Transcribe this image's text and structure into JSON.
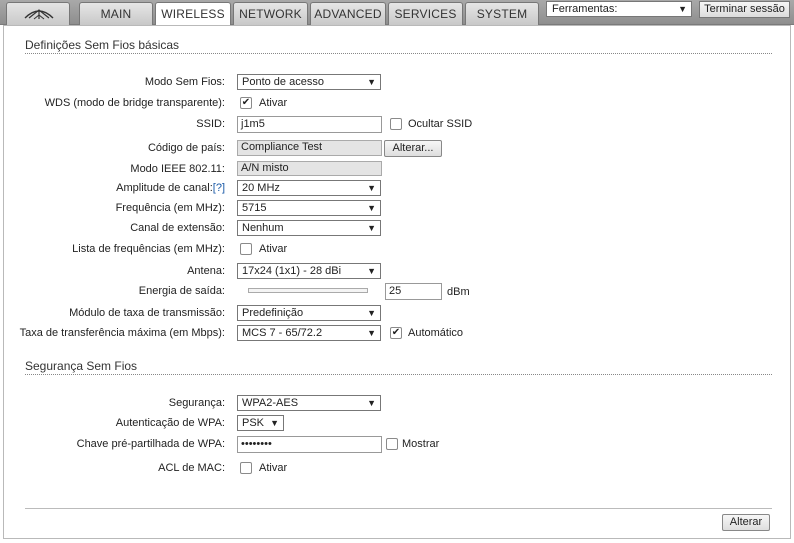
{
  "tabs": [
    {
      "label": "MAIN"
    },
    {
      "label": "WIRELESS"
    },
    {
      "label": "NETWORK"
    },
    {
      "label": "ADVANCED"
    },
    {
      "label": "SERVICES"
    },
    {
      "label": "SYSTEM"
    }
  ],
  "tools": {
    "selected": "Ferramentas:"
  },
  "logout_label": "Terminar sessão",
  "basic": {
    "title": "Definições Sem Fios básicas",
    "mode": {
      "label": "Modo Sem Fios:",
      "value": "Ponto de acesso"
    },
    "wds": {
      "label": "WDS (modo de bridge transparente):",
      "check_label": "Ativar",
      "checked": true
    },
    "ssid": {
      "label": "SSID:",
      "value": "j1m5",
      "hide_label": "Ocultar SSID"
    },
    "country": {
      "label": "Código de país:",
      "value": "Compliance Test",
      "change_button": "Alterar..."
    },
    "ieee": {
      "label": "Modo IEEE 802.11:",
      "value": "A/N misto"
    },
    "channel_width": {
      "label": "Amplitude de canal:",
      "help": "[?]",
      "value": "20 MHz"
    },
    "frequency": {
      "label": "Frequência (em MHz):",
      "value": "5715"
    },
    "extension": {
      "label": "Canal de extensão:",
      "value": "Nenhum"
    },
    "freq_list": {
      "label": "Lista de frequências (em MHz):",
      "check_label": "Ativar"
    },
    "antenna": {
      "label": "Antena:",
      "value": "17x24 (1x1) - 28 dBi"
    },
    "power": {
      "label": "Energia de saída:",
      "value": "25",
      "unit": "dBm"
    },
    "rate_module": {
      "label": "Módulo de taxa de transmissão:",
      "value": "Predefinição"
    },
    "max_rate": {
      "label": "Taxa de transferência máxima (em Mbps):",
      "value": "MCS 7 - 65/72.2",
      "auto_label": "Automático"
    }
  },
  "security": {
    "title": "Segurança Sem Fios",
    "security": {
      "label": "Segurança:",
      "value": "WPA2-AES"
    },
    "wpa_auth": {
      "label": "Autenticação de WPA:",
      "value": "PSK"
    },
    "wpa_key": {
      "label": "Chave pré-partilhada de WPA:",
      "value": "••••••••",
      "show_label": "Mostrar"
    },
    "mac_acl": {
      "label": "ACL de MAC:",
      "check_label": "Ativar"
    }
  },
  "apply_button": "Alterar"
}
